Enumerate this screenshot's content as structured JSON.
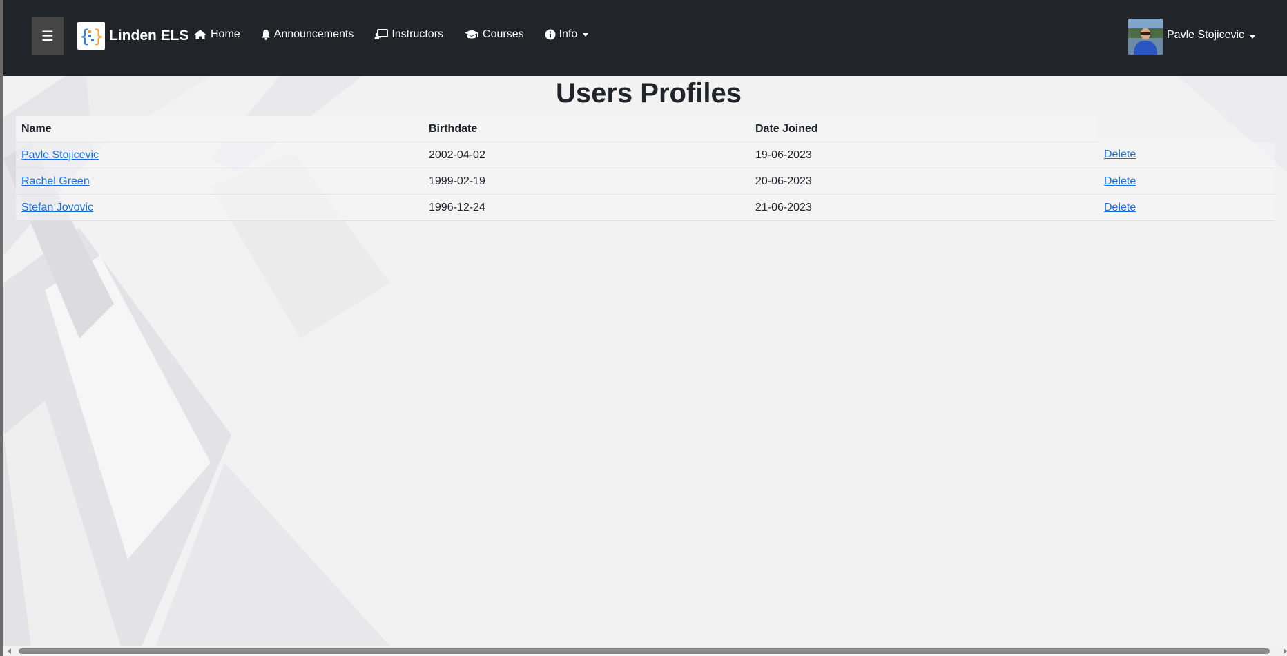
{
  "navbar": {
    "menu_icon": "☰",
    "brand": "Linden ELS",
    "links": [
      {
        "label": "Home",
        "icon": "home-icon"
      },
      {
        "label": "Announcements",
        "icon": "bell-icon"
      },
      {
        "label": "Instructors",
        "icon": "chalkboard-teacher-icon"
      },
      {
        "label": "Courses",
        "icon": "graduation-cap-icon"
      },
      {
        "label": "Info",
        "icon": "info-circle-icon"
      }
    ],
    "user": {
      "name": "Pavle Stojicevic"
    },
    "bg_color": "#212529"
  },
  "page": {
    "title": "Users Profiles"
  },
  "table": {
    "headers": [
      "Name",
      "Birthdate",
      "Date Joined"
    ],
    "rows": [
      {
        "name": "Pavle Stojicevic",
        "birthdate": "2002-04-02",
        "joined": "19-06-2023",
        "action": "Delete"
      },
      {
        "name": "Rachel Green",
        "birthdate": "1999-02-19",
        "joined": "20-06-2023",
        "action": "Delete"
      },
      {
        "name": "Stefan Jovovic",
        "birthdate": "1996-12-24",
        "joined": "21-06-2023",
        "action": "Delete"
      }
    ]
  },
  "colors": {
    "link": "#1a6ee6",
    "text": "#212529"
  }
}
